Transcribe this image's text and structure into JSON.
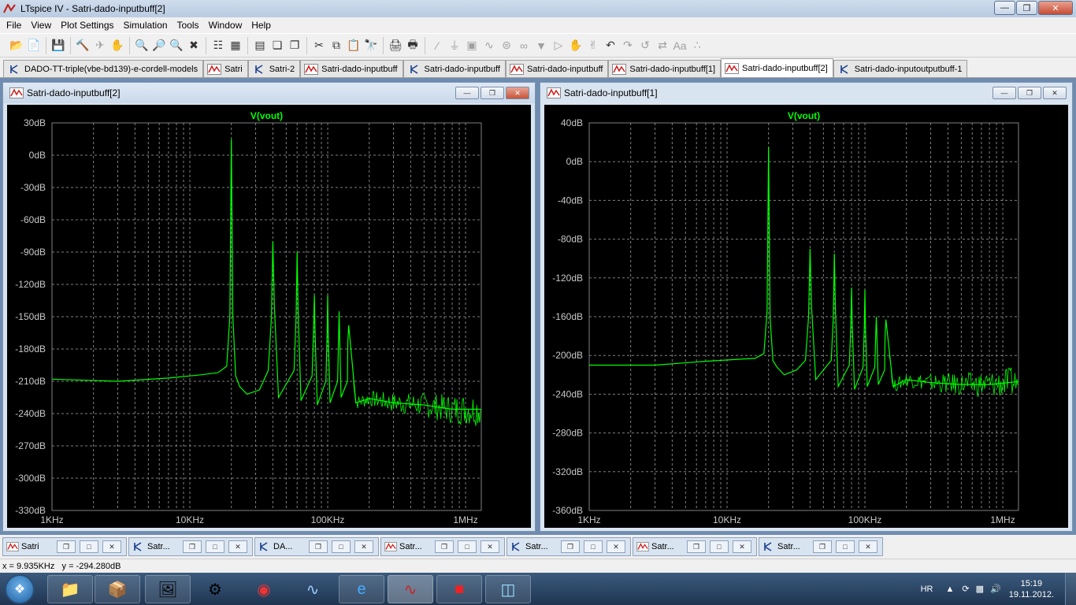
{
  "titlebar": {
    "title": "LTspice IV - Satri-dado-inputbuff[2]"
  },
  "menu": [
    "File",
    "View",
    "Plot Settings",
    "Simulation",
    "Tools",
    "Window",
    "Help"
  ],
  "tabs": [
    {
      "label": "DADO-TT-triple(vbe-bd139)-e-cordell-models",
      "kind": "schematic"
    },
    {
      "label": "Satri",
      "kind": "plot"
    },
    {
      "label": "Satri-2",
      "kind": "schematic"
    },
    {
      "label": "Satri-dado-inputbuff",
      "kind": "plot"
    },
    {
      "label": "Satri-dado-inputbuff",
      "kind": "schematic"
    },
    {
      "label": "Satri-dado-inputbuff",
      "kind": "plot"
    },
    {
      "label": "Satri-dado-inputbuff[1]",
      "kind": "plot"
    },
    {
      "label": "Satri-dado-inputbuff[2]",
      "kind": "plot",
      "active": true
    },
    {
      "label": "Satri-dado-inputoutputbuff-1",
      "kind": "schematic"
    }
  ],
  "windows": {
    "left": {
      "title": "Satri-dado-inputbuff[2]"
    },
    "right": {
      "title": "Satri-dado-inputbuff[1]"
    }
  },
  "chart_data": [
    {
      "type": "line",
      "title": "V(vout)",
      "x_scale": "log",
      "xlim": [
        1000,
        1300000
      ],
      "ylim": [
        -330,
        30
      ],
      "y_ticks": [
        "30dB",
        "0dB",
        "-30dB",
        "-60dB",
        "-90dB",
        "-120dB",
        "-150dB",
        "-180dB",
        "-210dB",
        "-240dB",
        "-270dB",
        "-300dB",
        "-330dB"
      ],
      "x_ticks": [
        "1KHz",
        "10KHz",
        "100KHz",
        "1MHz"
      ],
      "series": [
        {
          "color": "#00ff00",
          "x": [
            1000,
            3000,
            7000,
            12000,
            16000,
            18500,
            19500,
            20000,
            20500,
            21500,
            23000,
            26000,
            32000,
            37000,
            39000,
            40000,
            41000,
            44000,
            57000,
            59000,
            60000,
            61000,
            64000,
            77000,
            79000,
            80000,
            81000,
            84000,
            97000,
            99000,
            100000,
            101000,
            104000,
            118000,
            120000,
            121000,
            125000,
            139000,
            140000,
            142000,
            160000,
            200000,
            300000,
            500000,
            800000,
            1300000
          ],
          "y": [
            -208,
            -210,
            -207,
            -204,
            -202,
            -196,
            -150,
            15,
            -150,
            -205,
            -215,
            -222,
            -218,
            -200,
            -152,
            -80,
            -140,
            -225,
            -200,
            -150,
            -90,
            -145,
            -228,
            -205,
            -160,
            -130,
            -165,
            -232,
            -210,
            -165,
            -130,
            -168,
            -230,
            -210,
            -168,
            -145,
            -225,
            -210,
            -173,
            -158,
            -230,
            -226,
            -230,
            -232,
            -236,
            -236
          ]
        }
      ]
    },
    {
      "type": "line",
      "title": "V(vout)",
      "x_scale": "log",
      "xlim": [
        1000,
        1300000
      ],
      "ylim": [
        -360,
        40
      ],
      "y_ticks": [
        "40dB",
        "0dB",
        "-40dB",
        "-80dB",
        "-120dB",
        "-160dB",
        "-200dB",
        "-240dB",
        "-280dB",
        "-320dB",
        "-360dB"
      ],
      "x_ticks": [
        "1KHz",
        "10KHz",
        "100KHz",
        "1MHz"
      ],
      "series": [
        {
          "color": "#00ff00",
          "x": [
            1000,
            3000,
            7000,
            12000,
            16000,
            18500,
            19500,
            20000,
            20500,
            21500,
            23000,
            26000,
            32000,
            37000,
            39000,
            40000,
            41000,
            44000,
            57000,
            59000,
            60000,
            61000,
            64000,
            77000,
            79000,
            80000,
            81000,
            84000,
            97000,
            99000,
            100000,
            101000,
            104000,
            118000,
            120000,
            121000,
            125000,
            139000,
            140000,
            142000,
            160000,
            200000,
            300000,
            500000,
            800000,
            1300000
          ],
          "y": [
            -210,
            -210,
            -206,
            -204,
            -203,
            -198,
            -155,
            15,
            -160,
            -205,
            -212,
            -220,
            -215,
            -205,
            -160,
            -90,
            -150,
            -225,
            -205,
            -160,
            -95,
            -150,
            -232,
            -210,
            -170,
            -130,
            -170,
            -235,
            -212,
            -170,
            -132,
            -172,
            -232,
            -212,
            -175,
            -160,
            -230,
            -215,
            -180,
            -163,
            -232,
            -225,
            -228,
            -230,
            -230,
            -227
          ]
        }
      ]
    }
  ],
  "minimized": [
    {
      "label": "Satri",
      "kind": "plot"
    },
    {
      "label": "Satr...",
      "kind": "schematic"
    },
    {
      "label": "DA...",
      "kind": "schematic"
    },
    {
      "label": "Satr...",
      "kind": "plot"
    },
    {
      "label": "Satr...",
      "kind": "schematic"
    },
    {
      "label": "Satr...",
      "kind": "plot"
    },
    {
      "label": "Satr...",
      "kind": "schematic"
    }
  ],
  "status": {
    "text": "x = 9.935KHz   y = -294.280dB"
  },
  "taskbar": {
    "apps": [
      "explorer-icon",
      "setup-icon",
      "picture-icon",
      "tool-icon",
      "ccleaner-icon",
      "scope-icon",
      "ie-icon",
      "ltspice-icon",
      "pdf-icon",
      "notepad-icon"
    ],
    "lang": "HR",
    "time": "15:19",
    "date": "19.11.2012."
  }
}
